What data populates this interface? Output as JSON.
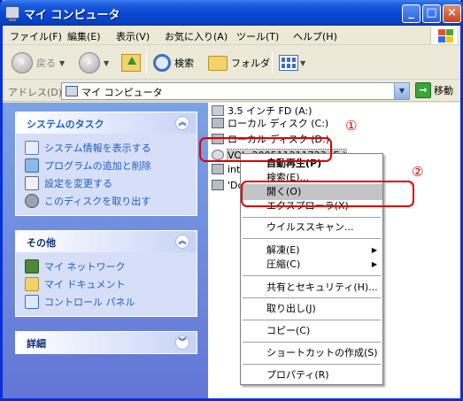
{
  "window": {
    "title": "マイ コンピュータ"
  },
  "menu": {
    "items": [
      "ファイル(F)",
      "編集(E)",
      "表示(V)",
      "お気に入り(A)",
      "ツール(T)",
      "ヘルプ(H)"
    ]
  },
  "toolbar": {
    "back_label": "戻る",
    "search_label": "検索",
    "folder_label": "フォルダ"
  },
  "address": {
    "label": "アドレス(D)",
    "value": "マイ コンピュータ",
    "go_label": "移動"
  },
  "left": {
    "system_tasks": {
      "title": "システムのタスク",
      "items": [
        "システム情報を表示する",
        "プログラムの追加と削除",
        "設定を変更する",
        "このディスクを取り出す"
      ]
    },
    "other": {
      "title": "その他",
      "items": [
        "マイ ネットワーク",
        "マイ ドキュメント",
        "コントロール パネル"
      ]
    },
    "details": {
      "title": "詳細"
    }
  },
  "drives": [
    "3.5 インチ FD (A:)",
    "ローカル ディスク (C:)",
    "ローカル ディスク (D:)",
    "VOL_200511211723 (E:)",
    "intg-s",
    "'Dct"
  ],
  "context_menu": {
    "items": [
      "自動再生(P)",
      "検索(E)...",
      "開く(O)",
      "エクスプローラ(X)",
      "ウイルススキャン...",
      "解凍(E)",
      "圧縮(C)",
      "共有とセキュリティ(H)...",
      "取り出し(J)",
      "コピー(C)",
      "ショートカットの作成(S)",
      "プロパティ(R)"
    ]
  },
  "annotations": {
    "one": "①",
    "two": "②"
  },
  "colors": {
    "accent": "#215dc6",
    "annotation": "#e00000",
    "titlebar": "#0a48d6"
  }
}
